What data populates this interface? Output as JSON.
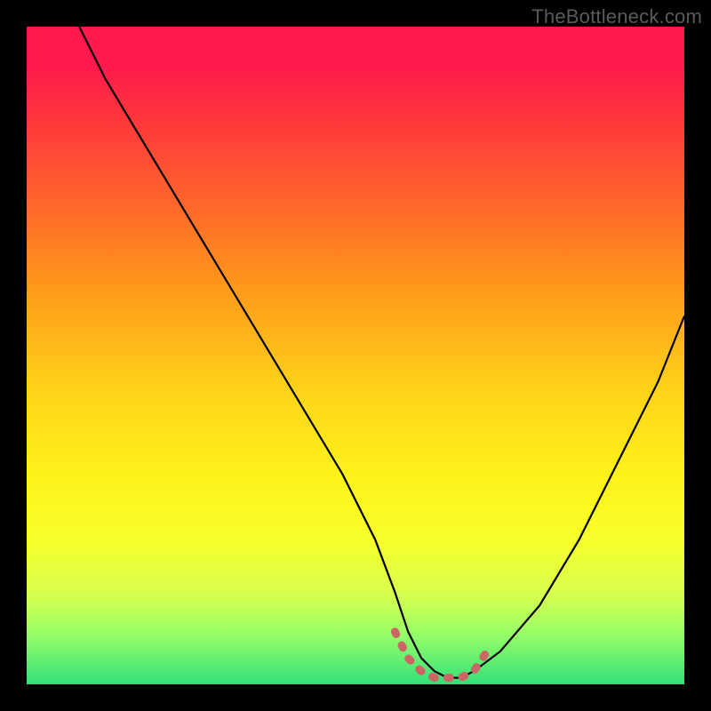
{
  "watermark": "TheBottleneck.com",
  "chart_data": {
    "type": "line",
    "title": "",
    "xlabel": "",
    "ylabel": "",
    "xlim": [
      0,
      100
    ],
    "ylim": [
      0,
      100
    ],
    "grid": false,
    "legend": false,
    "series": [
      {
        "name": "bottleneck-curve",
        "color": "#000000",
        "x": [
          8,
          12,
          18,
          24,
          30,
          36,
          42,
          48,
          53,
          56,
          58,
          60,
          62,
          64,
          66,
          68,
          72,
          78,
          84,
          90,
          96,
          100
        ],
        "y": [
          100,
          92,
          82,
          72,
          62,
          52,
          42,
          32,
          22,
          14,
          8,
          4,
          2,
          1,
          1,
          2,
          5,
          12,
          22,
          34,
          46,
          56
        ]
      },
      {
        "name": "highlight-band",
        "color": "#cc6666",
        "style": "dotted-thick",
        "x": [
          56,
          58,
          60,
          62,
          64,
          66,
          68,
          70
        ],
        "y": [
          8,
          4,
          2,
          1,
          1,
          1,
          2,
          5
        ]
      }
    ]
  },
  "colors": {
    "background": "#000000",
    "gradient_top": "#ff1a4d",
    "gradient_mid": "#fff21a",
    "gradient_bottom": "#33e07a",
    "highlight": "#cc6666"
  }
}
